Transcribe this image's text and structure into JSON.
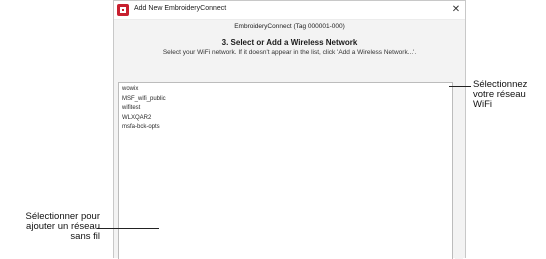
{
  "window": {
    "title": "Add New EmbroideryConnect",
    "close_glyph": "✕"
  },
  "header": {
    "device": "EmbroideryConnect (Tag 000001-000)",
    "step_title": "3. Select or Add a Wireless Network",
    "instruction": "Select your WiFi network. If it doesn't appear in the list, click 'Add a Wireless Network...'."
  },
  "networks": [
    "wowix",
    "MSF_wifi_public",
    "wifitest",
    "WLXQAR2",
    "msfa-bck-opts"
  ],
  "annotations": {
    "right": [
      "Sélectionnez",
      "votre réseau",
      "WiFi"
    ],
    "left": [
      "Sélectionner pour",
      "ajouter un réseau",
      "sans fil"
    ]
  },
  "colors": {
    "app_icon": "#c8202f"
  },
  "icons": {
    "app": "embroideryconnect-app-icon",
    "close": "close-icon"
  }
}
